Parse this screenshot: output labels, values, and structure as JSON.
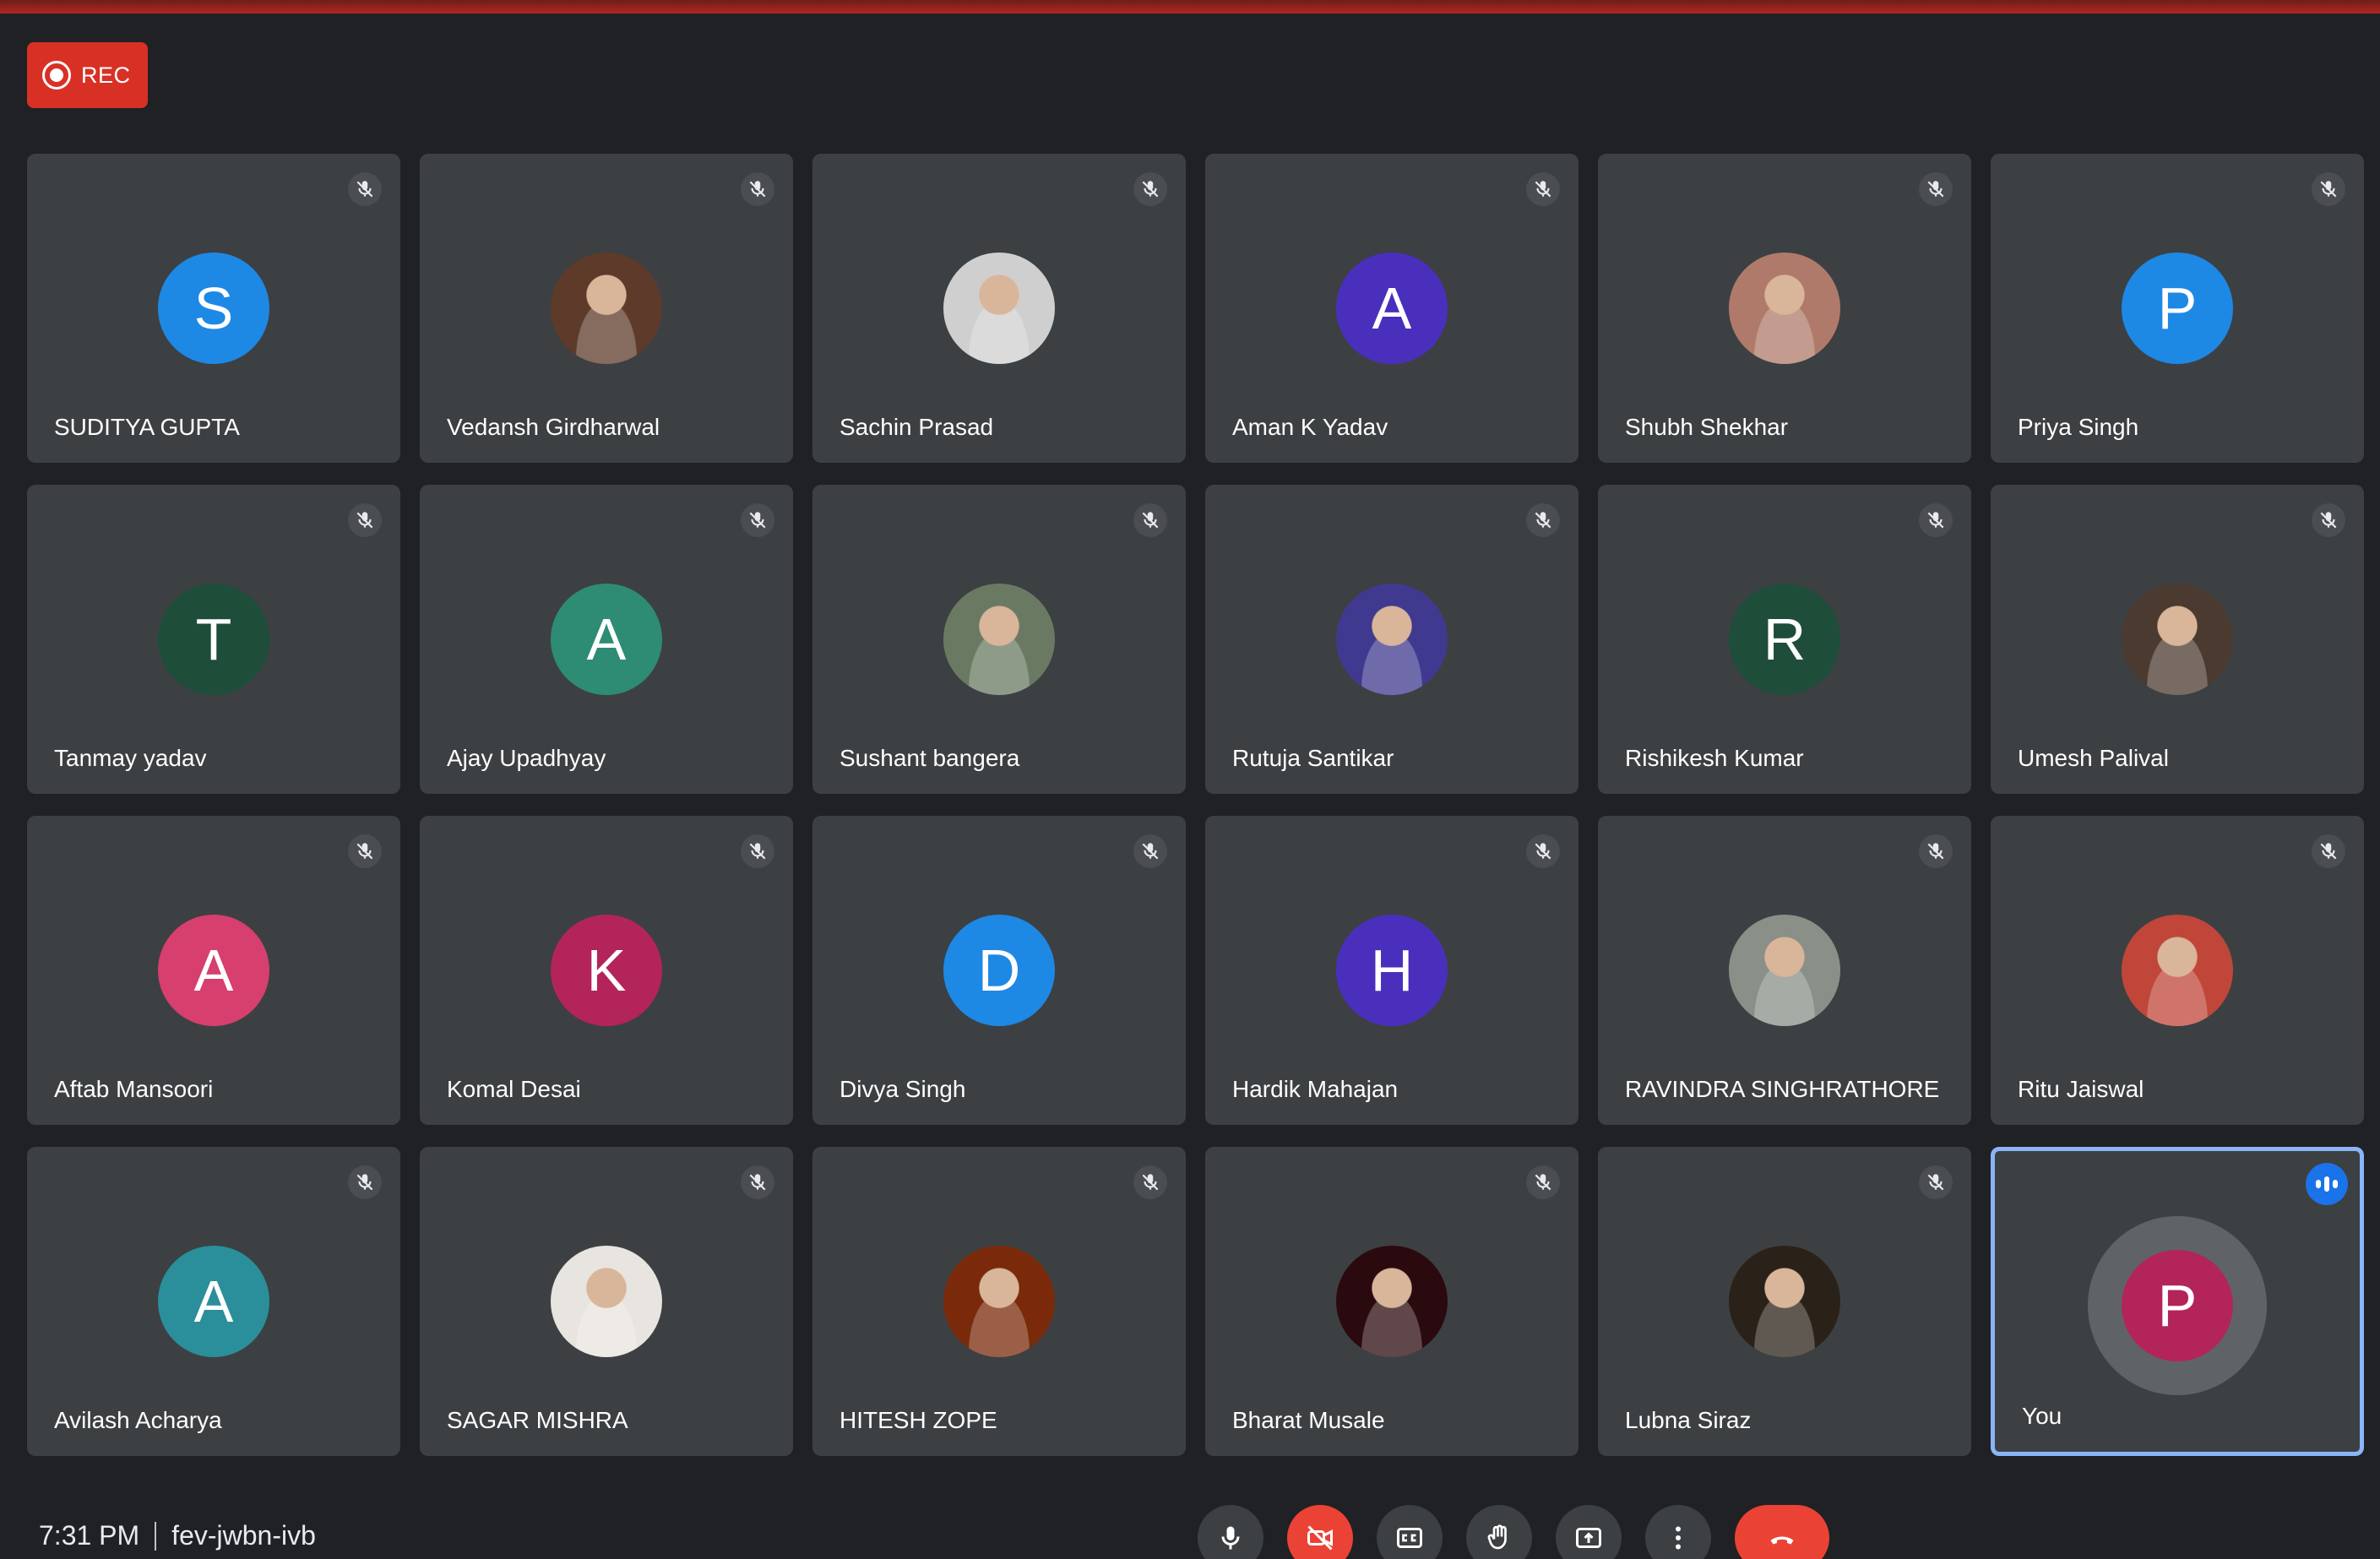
{
  "rec": {
    "label": "REC"
  },
  "participants": [
    {
      "name": "SUDITYA GUPTA",
      "initial": "S",
      "color": "#1e88e5",
      "photo": false
    },
    {
      "name": "Vedansh Girdharwal",
      "initial": "",
      "color": "#5d3a2a",
      "photo": true
    },
    {
      "name": "Sachin Prasad",
      "initial": "",
      "color": "#cfcfcf",
      "photo": true
    },
    {
      "name": "Aman K Yadav",
      "initial": "A",
      "color": "#4a2fbd",
      "photo": false
    },
    {
      "name": "Shubh Shekhar",
      "initial": "",
      "color": "#b07a6a",
      "photo": true
    },
    {
      "name": "Priya Singh",
      "initial": "P",
      "color": "#1e88e5",
      "photo": false
    },
    {
      "name": "Tanmay yadav",
      "initial": "T",
      "color": "#1e4d3a",
      "photo": false
    },
    {
      "name": "Ajay Upadhyay",
      "initial": "A",
      "color": "#2e8b74",
      "photo": false
    },
    {
      "name": "Sushant bangera",
      "initial": "",
      "color": "#6a7a62",
      "photo": true
    },
    {
      "name": "Rutuja Santikar",
      "initial": "",
      "color": "#3f3a8f",
      "photo": true
    },
    {
      "name": "Rishikesh Kumar",
      "initial": "R",
      "color": "#1e4d3a",
      "photo": false
    },
    {
      "name": "Umesh Palival",
      "initial": "",
      "color": "#4a3a30",
      "photo": true
    },
    {
      "name": "Aftab Mansoori",
      "initial": "A",
      "color": "#d63f6e",
      "photo": false
    },
    {
      "name": "Komal Desai",
      "initial": "K",
      "color": "#b3245a",
      "photo": false
    },
    {
      "name": "Divya Singh",
      "initial": "D",
      "color": "#1e88e5",
      "photo": false
    },
    {
      "name": "Hardik Mahajan",
      "initial": "H",
      "color": "#4a2fbd",
      "photo": false
    },
    {
      "name": "RAVINDRA SINGHRATHORE",
      "initial": "",
      "color": "#8a8f88",
      "photo": true
    },
    {
      "name": "Ritu Jaiswal",
      "initial": "",
      "color": "#c0463a",
      "photo": true
    },
    {
      "name": "Avilash Acharya",
      "initial": "A",
      "color": "#2a8f9a",
      "photo": false
    },
    {
      "name": "SAGAR MISHRA",
      "initial": "",
      "color": "#e8e4df",
      "photo": true
    },
    {
      "name": "HITESH ZOPE",
      "initial": "",
      "color": "#7a2a0a",
      "photo": true
    },
    {
      "name": "Bharat Musale",
      "initial": "",
      "color": "#2a0a0e",
      "photo": true
    },
    {
      "name": "Lubna Siraz",
      "initial": "",
      "color": "#2a2218",
      "photo": true
    },
    {
      "name": "You",
      "initial": "P",
      "color": "#b3245a",
      "photo": false,
      "self": true
    }
  ],
  "footer": {
    "time": "7:31 PM",
    "meeting_code": "fev-jwbn-ivb"
  },
  "controls": [
    "mic",
    "camera-off",
    "captions",
    "raise-hand",
    "present",
    "more-options",
    "leave-call"
  ]
}
